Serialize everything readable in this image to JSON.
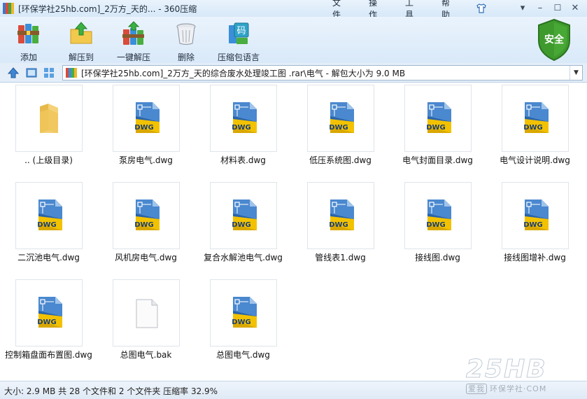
{
  "window": {
    "title": "[环保学社25hb.com]_2万方_天的... - 360压缩",
    "menu": [
      "文件",
      "操作",
      "工具",
      "帮助"
    ],
    "controls": {
      "minimize": "–",
      "maximize": "☐",
      "close": "✕"
    }
  },
  "toolbar": {
    "buttons": [
      {
        "label": "添加",
        "icon": "add-books-icon"
      },
      {
        "label": "解压到",
        "icon": "extract-to-folder-icon"
      },
      {
        "label": "一键解压",
        "icon": "one-click-extract-icon"
      },
      {
        "label": "删除",
        "icon": "trash-bin-icon"
      },
      {
        "label": "压缩包语言",
        "icon": "language-code-icon"
      }
    ],
    "security_badge": "安全",
    "language_icon_char": "码"
  },
  "address": {
    "path": "[环保学社25hb.com]_2万方_天的综合废水处理竣工图 .rar\\电气 - 解包大小为 9.0 MB"
  },
  "files": [
    {
      "name": ".. (上级目录)",
      "type": "folder"
    },
    {
      "name": "泵房电气.dwg",
      "type": "dwg"
    },
    {
      "name": "材料表.dwg",
      "type": "dwg"
    },
    {
      "name": "低压系统图.dwg",
      "type": "dwg"
    },
    {
      "name": "电气封面目录.dwg",
      "type": "dwg"
    },
    {
      "name": "电气设计说明.dwg",
      "type": "dwg"
    },
    {
      "name": "二沉池电气.dwg",
      "type": "dwg"
    },
    {
      "name": "风机房电气.dwg",
      "type": "dwg"
    },
    {
      "name": "复合水解池电气.dwg",
      "type": "dwg"
    },
    {
      "name": "管线表1.dwg",
      "type": "dwg"
    },
    {
      "name": "接线图.dwg",
      "type": "dwg"
    },
    {
      "name": "接线图增补.dwg",
      "type": "dwg"
    },
    {
      "name": "控制箱盘面布置图.dwg",
      "type": "dwg"
    },
    {
      "name": "总图电气.bak",
      "type": "blank"
    },
    {
      "name": "总图电气.dwg",
      "type": "dwg"
    }
  ],
  "icon_labels": {
    "dwg": "DWG"
  },
  "status": {
    "text": "大小: 2.9 MB 共 28 个文件和 2 个文件夹 压缩率 32.9%"
  },
  "watermark": {
    "logo": "25HB",
    "caption": "环保学社·COM",
    "badge": "爱我"
  },
  "colors": {
    "accent": "#2f6db5",
    "dwg_yellow": "#f2c200",
    "dwg_blue": "#2a63a8",
    "shield_green": "#3f9a2e"
  }
}
